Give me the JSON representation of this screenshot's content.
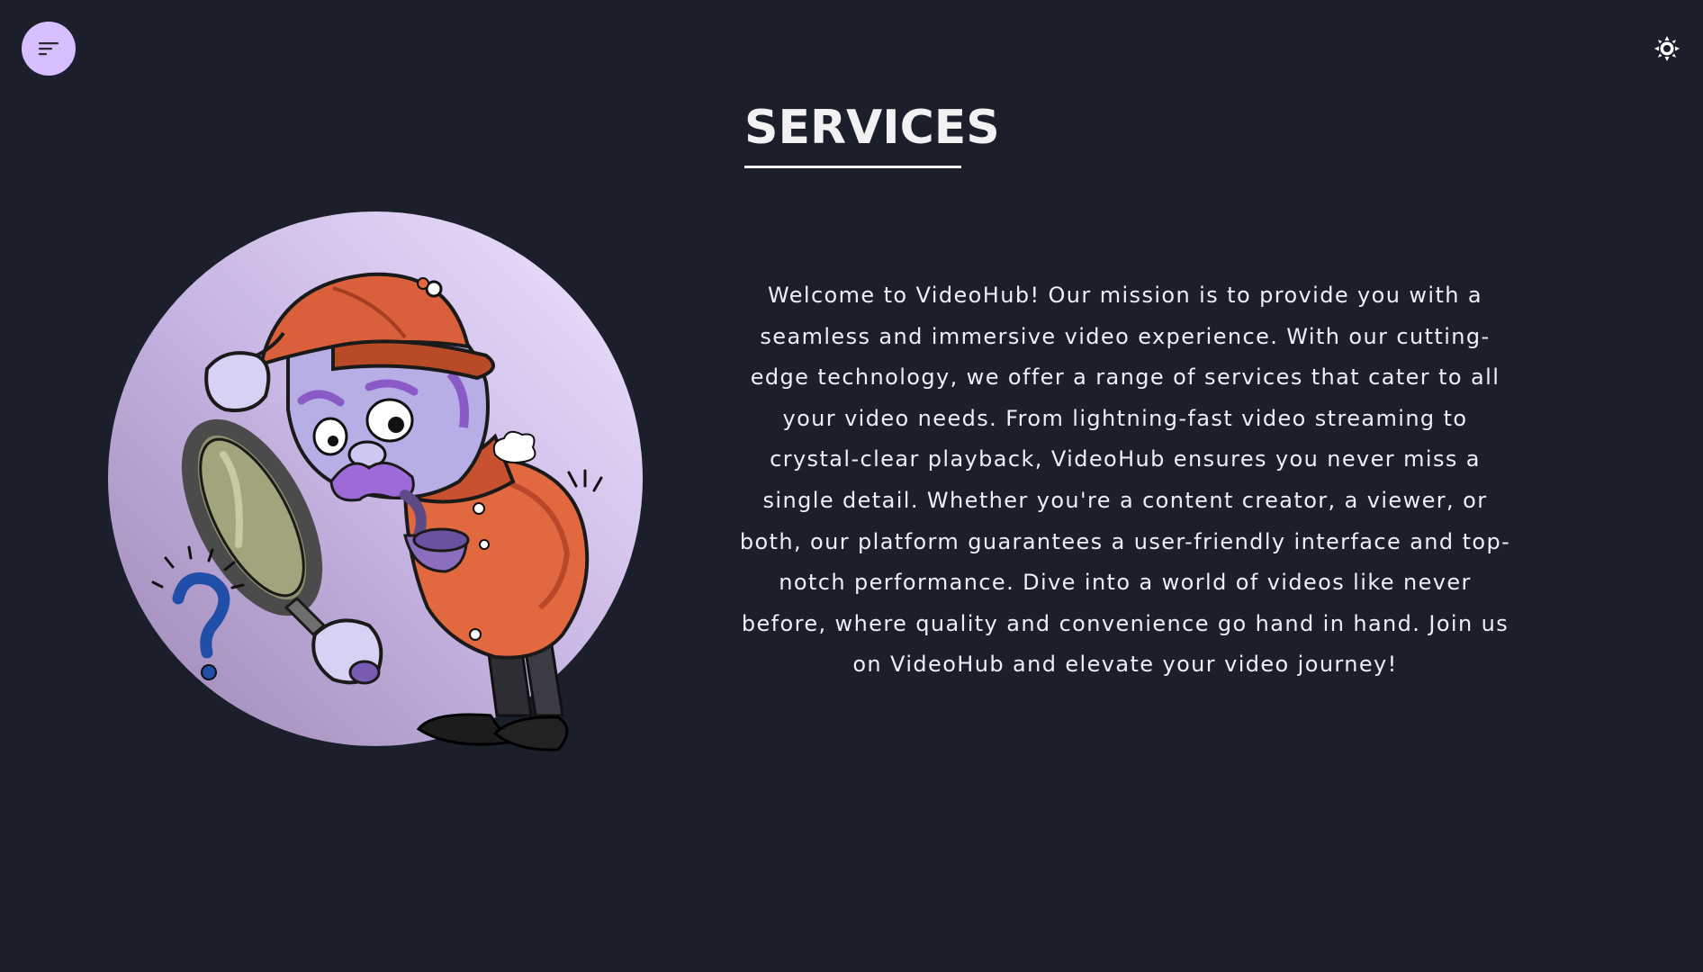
{
  "header": {
    "menu_icon": "menu-lines-icon",
    "theme_icon": "sun-icon"
  },
  "services": {
    "title": "SERVICES",
    "description": "Welcome to VideoHub! Our mission is to provide you with a seamless and immersive video experience. With our cutting-edge technology, we offer a range of services that cater to all your video needs. From lightning-fast video streaming to crystal-clear playback, VideoHub ensures you never miss a single detail. Whether you're a content creator, a viewer, or both, our platform guarantees a user-friendly interface and top-notch performance. Dive into a world of videos like never before, where quality and convenience go hand in hand. Join us on VideoHub and elevate your video journey!",
    "illustration": "detective-with-magnifying-glass"
  },
  "colors": {
    "background": "#1b1f2b",
    "accent": "#d7bfff",
    "text": "#eceff4"
  }
}
